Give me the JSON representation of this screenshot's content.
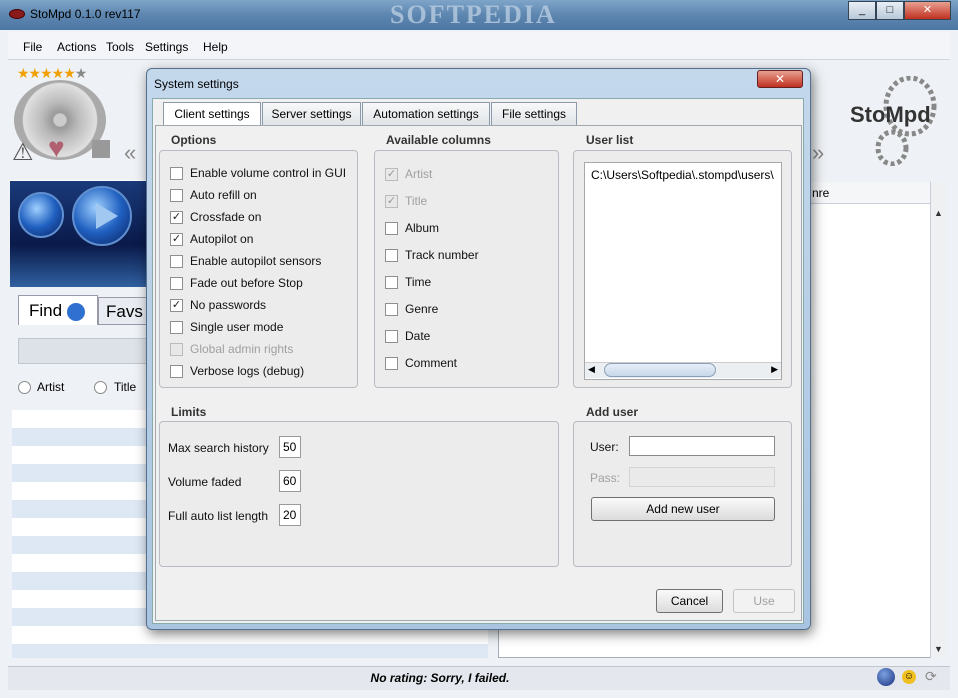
{
  "window": {
    "title": "StoMpd 0.1.0 rev117",
    "watermark": "SOFTPEDIA",
    "controls": [
      "_",
      "□",
      "✕"
    ]
  },
  "menu": [
    "File",
    "Actions",
    "Tools",
    "Settings",
    "Help"
  ],
  "player": {
    "rating_stars": 5,
    "rating_max": 6,
    "logo_text": "StoMpd"
  },
  "left_panel": {
    "tabs": [
      "Find",
      "Favs"
    ],
    "search_placeholder": "",
    "radios": [
      "Artist",
      "Title"
    ]
  },
  "right_panel": {
    "column_header": "nre"
  },
  "status": {
    "text": "No rating: Sorry, I failed."
  },
  "dialog": {
    "title": "System settings",
    "close_label": "✕",
    "tabs": [
      {
        "label": "Client settings",
        "active": true
      },
      {
        "label": "Server settings",
        "active": false
      },
      {
        "label": "Automation settings",
        "active": false
      },
      {
        "label": "File settings",
        "active": false
      }
    ],
    "options": {
      "title": "Options",
      "items": [
        {
          "label": "Enable volume control in GUI",
          "checked": false,
          "disabled": false
        },
        {
          "label": "Auto refill on",
          "checked": false,
          "disabled": false
        },
        {
          "label": "Crossfade on",
          "checked": true,
          "disabled": false
        },
        {
          "label": "Autopilot on",
          "checked": true,
          "disabled": false
        },
        {
          "label": "Enable autopilot sensors",
          "checked": false,
          "disabled": false
        },
        {
          "label": "Fade out before Stop",
          "checked": false,
          "disabled": false
        },
        {
          "label": "No passwords",
          "checked": true,
          "disabled": false
        },
        {
          "label": "Single user mode",
          "checked": false,
          "disabled": false
        },
        {
          "label": "Global admin rights",
          "checked": false,
          "disabled": true
        },
        {
          "label": "Verbose logs (debug)",
          "checked": false,
          "disabled": false
        }
      ]
    },
    "columns": {
      "title": "Available columns",
      "items": [
        {
          "label": "Artist",
          "checked": true,
          "disabled": true
        },
        {
          "label": "Title",
          "checked": true,
          "disabled": true
        },
        {
          "label": "Album",
          "checked": false,
          "disabled": false
        },
        {
          "label": "Track number",
          "checked": false,
          "disabled": false
        },
        {
          "label": "Time",
          "checked": false,
          "disabled": false
        },
        {
          "label": "Genre",
          "checked": false,
          "disabled": false
        },
        {
          "label": "Date",
          "checked": false,
          "disabled": false
        },
        {
          "label": "Comment",
          "checked": false,
          "disabled": false
        }
      ]
    },
    "user_list": {
      "title": "User list",
      "items": [
        "C:\\Users\\Softpedia\\.stompd\\users\\"
      ]
    },
    "limits": {
      "title": "Limits",
      "fields": [
        {
          "label": "Max search history",
          "value": "50"
        },
        {
          "label": "Volume faded",
          "value": "60"
        },
        {
          "label": "Full auto list length",
          "value": "20"
        }
      ]
    },
    "add_user": {
      "title": "Add user",
      "user_label": "User:",
      "user_value": "",
      "pass_label": "Pass:",
      "pass_value": "",
      "button": "Add new user"
    },
    "buttons": {
      "cancel": "Cancel",
      "use": "Use"
    }
  }
}
